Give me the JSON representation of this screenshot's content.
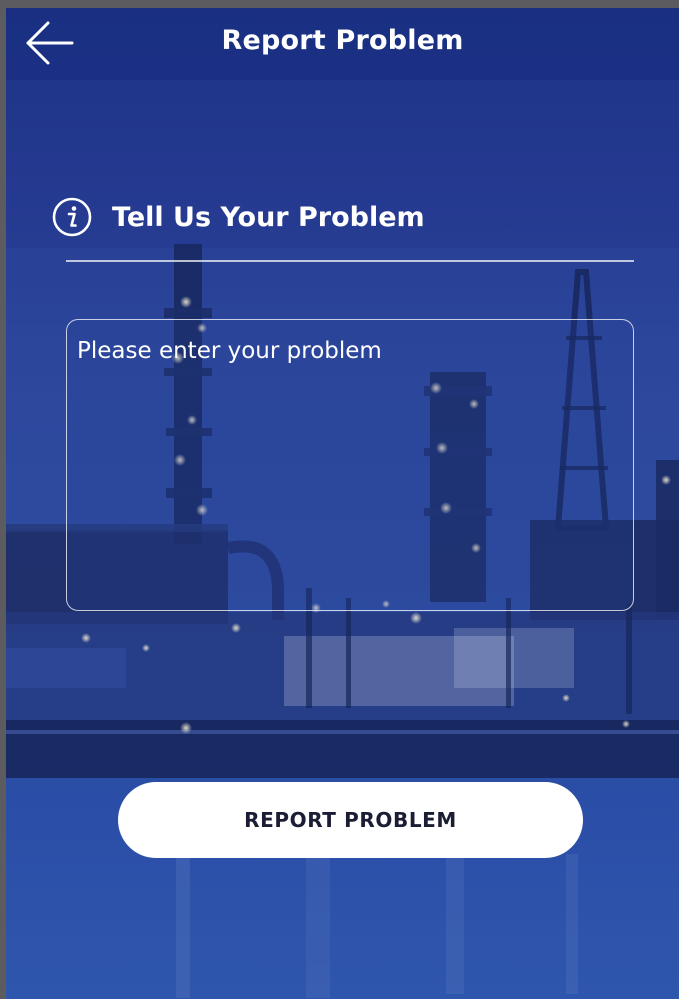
{
  "header": {
    "title": "Report Problem",
    "back_icon": "arrow-left-icon"
  },
  "section": {
    "icon": "info-icon",
    "title": "Tell Us Your Problem"
  },
  "form": {
    "problem_value": "",
    "problem_placeholder": "Please enter your problem"
  },
  "actions": {
    "report_label": "REPORT PROBLEM"
  },
  "colors": {
    "background": "#2b4599",
    "header": "#1d3486",
    "button_bg": "#ffffff",
    "button_text": "#1a1d33",
    "text": "#ffffff"
  }
}
